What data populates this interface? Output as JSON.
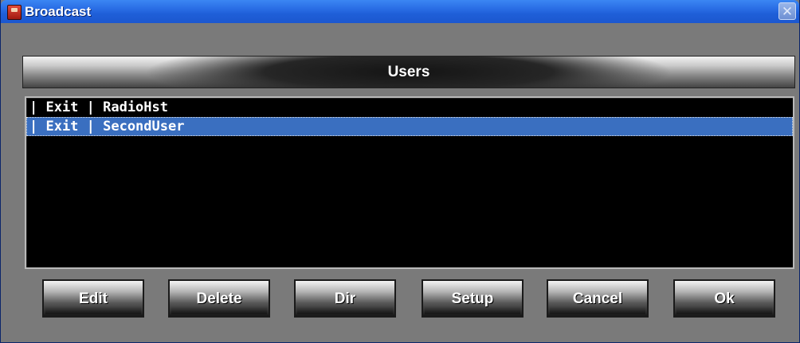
{
  "window": {
    "title": "Broadcast",
    "close_glyph": "✕"
  },
  "header": {
    "label": "Users"
  },
  "users_list": {
    "rows": [
      {
        "text": "| Exit | RadioHst",
        "selected": false
      },
      {
        "text": "| Exit | SecondUser",
        "selected": true
      }
    ]
  },
  "buttons": {
    "edit": "Edit",
    "delete": "Delete",
    "dir": "Dir",
    "setup": "Setup",
    "cancel": "Cancel",
    "ok": "Ok"
  },
  "colors": {
    "titlebar": "#2b6fe6",
    "selection": "#3a6fc0",
    "list_background": "#000000"
  },
  "icons": {
    "app": "broadcast-app-icon",
    "close": "close-icon"
  }
}
